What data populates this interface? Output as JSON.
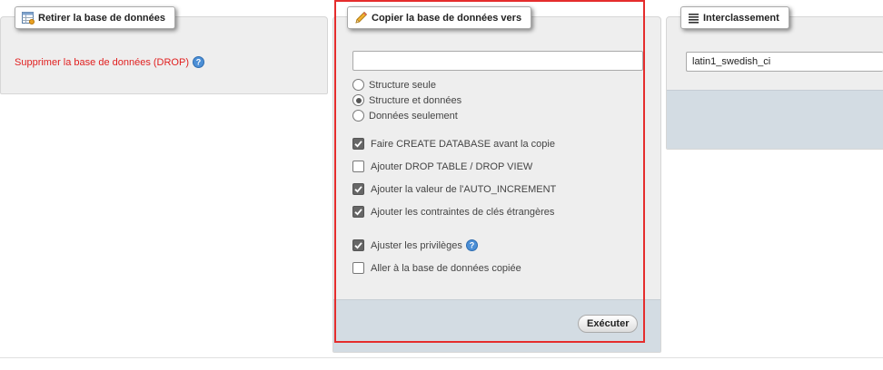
{
  "drop_panel": {
    "legend": "Retirer la base de données",
    "link": "Supprimer la base de données (DROP)"
  },
  "copy_panel": {
    "legend": "Copier la base de données vers",
    "input_value": "",
    "radios": [
      {
        "label": "Structure seule",
        "checked": false
      },
      {
        "label": "Structure et données",
        "checked": true
      },
      {
        "label": "Données seulement",
        "checked": false
      }
    ],
    "checkboxes": [
      {
        "label": "Faire CREATE DATABASE avant la copie",
        "checked": true
      },
      {
        "label": "Ajouter DROP TABLE / DROP VIEW",
        "checked": false
      },
      {
        "label": "Ajouter la valeur de l'AUTO_INCREMENT",
        "checked": true
      },
      {
        "label": "Ajouter les contraintes de clés étrangères",
        "checked": true
      },
      {
        "label": "Ajuster les privilèges",
        "checked": true
      },
      {
        "label": "Aller à la base de données copiée",
        "checked": false
      }
    ],
    "submit_label": "Exécuter"
  },
  "collation_panel": {
    "legend": "Interclassement",
    "value": "latin1_swedish_ci"
  },
  "colors": {
    "link_red": "#e12020",
    "highlight_red": "#e52d2d",
    "footer_bar": "#d3dce3",
    "panel_bg": "#eeeeee"
  }
}
